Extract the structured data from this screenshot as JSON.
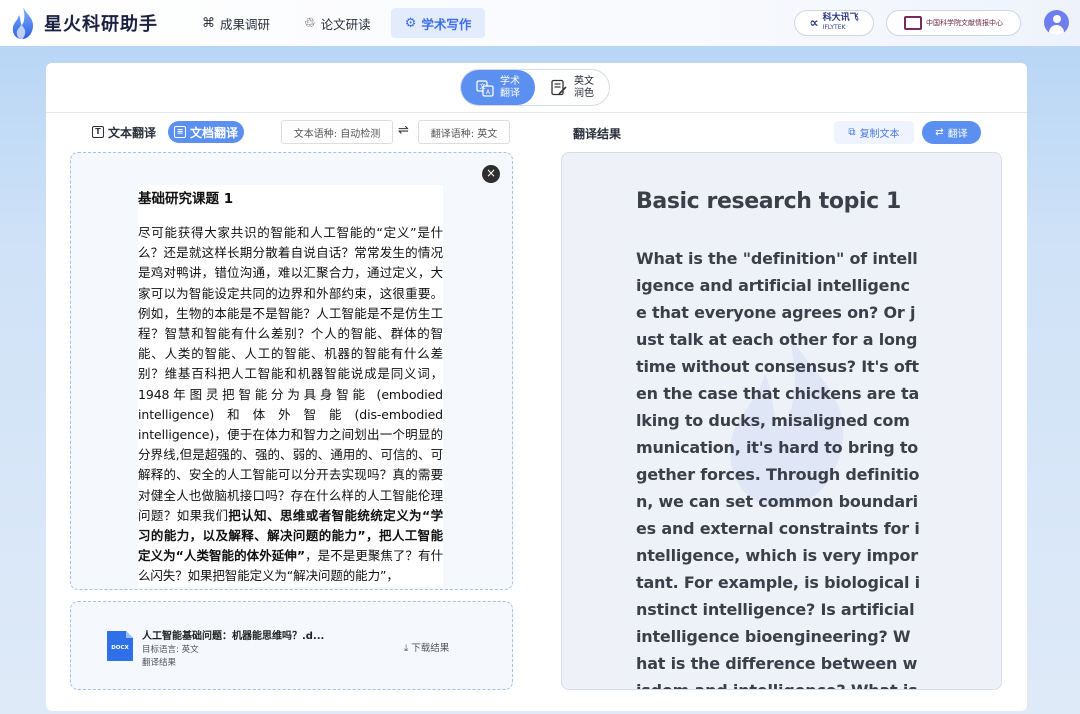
{
  "app": {
    "name": "星火科研助手"
  },
  "nav": {
    "items": [
      {
        "label": "成果调研",
        "icon": "chart-icon"
      },
      {
        "label": "论文研读",
        "icon": "read-icon"
      },
      {
        "label": "学术写作",
        "icon": "write-icon",
        "active": true
      }
    ]
  },
  "partners": {
    "iflytek_line1": "科大讯飞",
    "iflytek_line2": "IFLYTEK",
    "cas": "中国科学院文献情报中心"
  },
  "segment": {
    "translate_line1": "学术",
    "translate_line2": "翻译",
    "polish_line1": "英文",
    "polish_line2": "润色"
  },
  "toolbar": {
    "text_translate": "文本翻译",
    "doc_translate": "文档翻译",
    "source_lang": "文本语种: 自动检测",
    "swap_symbol": "⇌",
    "target_lang": "翻译语种: 英文",
    "result_title": "翻译结果",
    "copy_label": "复制文本",
    "translate_label": "翻译"
  },
  "document": {
    "title": "基础研究课题 1",
    "body_part1": "尽可能获得大家共识的智能和人工智能的“定义”是什么？还是就这样长期分散着自说自话？常常发生的情况是鸡对鸭讲，错位沟通，难以汇聚合力，通过定义，大家可以为智能设定共同的边界和外部约束，这很重要。例如，生物的本能是不是智能？人工智能是不是仿生工程？智慧和智能有什么差别？个人的智能、群体的智能、人类的智能、人工的智能、机器的智能有什么差别？维基百科把人工智能和机器智能说成是同义词，1948年图灵把智能分为具身智能 (embodied intelligence)和体外智能(dis-embodied intelligence)，便于在体力和智力之间划出一个明显的分界线,但是超强的、强的、弱的、通用的、可信的、可解释的、安全的人工智能可以分开去实现吗？真的需要对健全人也做脑机接口吗？存在什么样的人工智能伦理问题？如果我们",
    "body_bold": "把认知、思维或者智能统统定义为“学习的能力，以及解释、解决问题的能力”，把人工智能定义为“人类智能的体外延伸”",
    "body_part2": "，是不是更聚焦了？有什么闪失？如果把智能定义为“解决问题的能力”，"
  },
  "file": {
    "name": "人工智能基础问题：机器能思维吗？.d...",
    "target_lang": "目标语言: 英文",
    "status": "翻译结果",
    "download_label": "下载结果",
    "type_label": "DOCX"
  },
  "result": {
    "title": "Basic research topic 1",
    "body": "What is the \"definition\" of intelligence and artificial intelligence that everyone agrees on? Or just talk at each other for a long time without consensus? It's often the case that chickens are talking to ducks, misaligned communication, it's hard to bring together forces. Through definition, we can set common boundaries and external constraints for intelligence, which is very important. For example, is biological instinct intelligence? Is artificial intelligence bioengineering? What is the difference between wisdom and intelligence? What is the difference between perso"
  },
  "colors": {
    "accent": "#5b8ff0",
    "nav_active_bg": "#e3ecfd",
    "dashed_border": "#a6c0ea"
  }
}
